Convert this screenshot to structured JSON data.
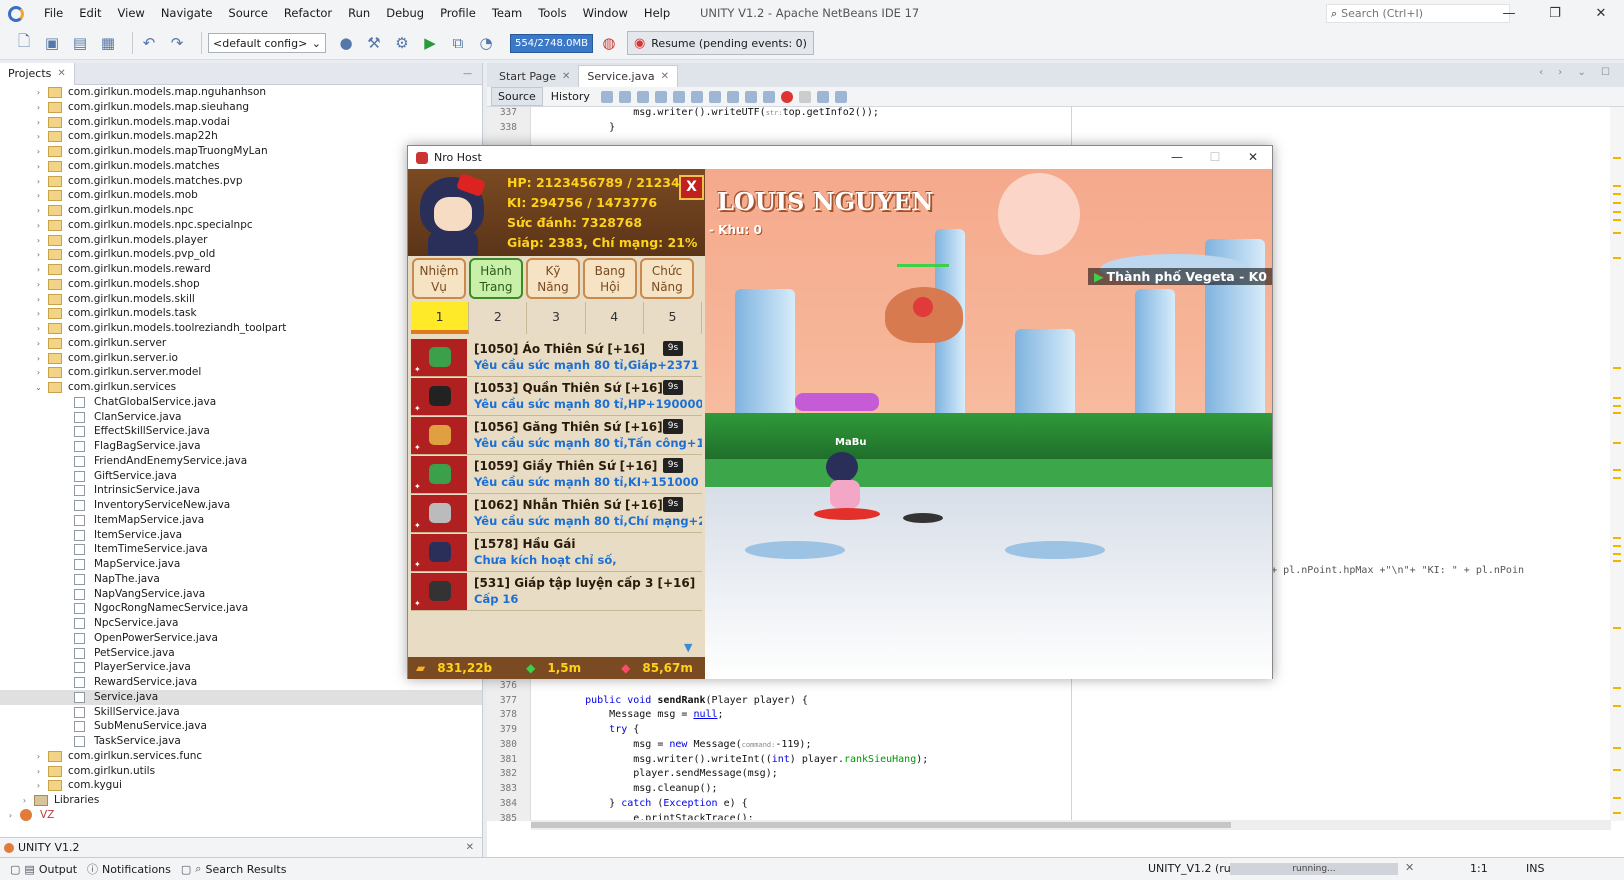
{
  "window": {
    "title": "UNITY V1.2 - Apache NetBeans IDE 17",
    "minimize": "—",
    "maximize": "❐",
    "close": "✕"
  },
  "menu": [
    "File",
    "Edit",
    "View",
    "Navigate",
    "Source",
    "Refactor",
    "Run",
    "Debug",
    "Profile",
    "Team",
    "Tools",
    "Window",
    "Help"
  ],
  "search": {
    "placeholder": "Search (Ctrl+I)"
  },
  "toolbar": {
    "config": "<default config>",
    "memory": "554/2748.0MB",
    "resume": "Resume (pending events: 0)"
  },
  "projects": {
    "tab": "Projects",
    "close": "✕",
    "minimize": "—",
    "rows": [
      {
        "text": "com.girlkun.models.map.nguhanhson",
        "kind": "pkg",
        "indent": 2,
        "tw": "›"
      },
      {
        "text": "com.girlkun.models.map.sieuhang",
        "kind": "pkg",
        "indent": 2,
        "tw": "›"
      },
      {
        "text": "com.girlkun.models.map.vodai",
        "kind": "pkg",
        "indent": 2,
        "tw": "›"
      },
      {
        "text": "com.girlkun.models.map22h",
        "kind": "pkg",
        "indent": 2,
        "tw": "›"
      },
      {
        "text": "com.girlkun.models.mapTruongMyLan",
        "kind": "pkg",
        "indent": 2,
        "tw": "›"
      },
      {
        "text": "com.girlkun.models.matches",
        "kind": "pkg",
        "indent": 2,
        "tw": "›"
      },
      {
        "text": "com.girlkun.models.matches.pvp",
        "kind": "pkg",
        "indent": 2,
        "tw": "›"
      },
      {
        "text": "com.girlkun.models.mob",
        "kind": "pkg",
        "indent": 2,
        "tw": "›"
      },
      {
        "text": "com.girlkun.models.npc",
        "kind": "pkg",
        "indent": 2,
        "tw": "›"
      },
      {
        "text": "com.girlkun.models.npc.specialnpc",
        "kind": "pkg",
        "indent": 2,
        "tw": "›"
      },
      {
        "text": "com.girlkun.models.player",
        "kind": "pkg",
        "indent": 2,
        "tw": "›"
      },
      {
        "text": "com.girlkun.models.pvp_old",
        "kind": "pkg",
        "indent": 2,
        "tw": "›"
      },
      {
        "text": "com.girlkun.models.reward",
        "kind": "pkg",
        "indent": 2,
        "tw": "›"
      },
      {
        "text": "com.girlkun.models.shop",
        "kind": "pkg",
        "indent": 2,
        "tw": "›"
      },
      {
        "text": "com.girlkun.models.skill",
        "kind": "pkg",
        "indent": 2,
        "tw": "›"
      },
      {
        "text": "com.girlkun.models.task",
        "kind": "pkg",
        "indent": 2,
        "tw": "›"
      },
      {
        "text": "com.girlkun.models.toolreziandh_toolpart",
        "kind": "pkg",
        "indent": 2,
        "tw": "›"
      },
      {
        "text": "com.girlkun.server",
        "kind": "pkg",
        "indent": 2,
        "tw": "›"
      },
      {
        "text": "com.girlkun.server.io",
        "kind": "pkg",
        "indent": 2,
        "tw": "›"
      },
      {
        "text": "com.girlkun.server.model",
        "kind": "pkg",
        "indent": 2,
        "tw": "›"
      },
      {
        "text": "com.girlkun.services",
        "kind": "pkg",
        "indent": 2,
        "tw": "⌄"
      },
      {
        "text": "ChatGlobalService.java",
        "kind": "file",
        "indent": 3,
        "tw": ""
      },
      {
        "text": "ClanService.java",
        "kind": "file",
        "indent": 3,
        "tw": ""
      },
      {
        "text": "EffectSkillService.java",
        "kind": "file",
        "indent": 3,
        "tw": ""
      },
      {
        "text": "FlagBagService.java",
        "kind": "file",
        "indent": 3,
        "tw": ""
      },
      {
        "text": "FriendAndEnemyService.java",
        "kind": "file",
        "indent": 3,
        "tw": ""
      },
      {
        "text": "GiftService.java",
        "kind": "file",
        "indent": 3,
        "tw": ""
      },
      {
        "text": "IntrinsicService.java",
        "kind": "file",
        "indent": 3,
        "tw": ""
      },
      {
        "text": "InventoryServiceNew.java",
        "kind": "file",
        "indent": 3,
        "tw": ""
      },
      {
        "text": "ItemMapService.java",
        "kind": "file",
        "indent": 3,
        "tw": ""
      },
      {
        "text": "ItemService.java",
        "kind": "file",
        "indent": 3,
        "tw": ""
      },
      {
        "text": "ItemTimeService.java",
        "kind": "file",
        "indent": 3,
        "tw": ""
      },
      {
        "text": "MapService.java",
        "kind": "file",
        "indent": 3,
        "tw": ""
      },
      {
        "text": "NapThe.java",
        "kind": "file",
        "indent": 3,
        "tw": ""
      },
      {
        "text": "NapVangService.java",
        "kind": "file",
        "indent": 3,
        "tw": ""
      },
      {
        "text": "NgocRongNamecService.java",
        "kind": "file",
        "indent": 3,
        "tw": ""
      },
      {
        "text": "NpcService.java",
        "kind": "file",
        "indent": 3,
        "tw": ""
      },
      {
        "text": "OpenPowerService.java",
        "kind": "file",
        "indent": 3,
        "tw": ""
      },
      {
        "text": "PetService.java",
        "kind": "file",
        "indent": 3,
        "tw": ""
      },
      {
        "text": "PlayerService.java",
        "kind": "file",
        "indent": 3,
        "tw": ""
      },
      {
        "text": "RewardService.java",
        "kind": "file",
        "indent": 3,
        "tw": ""
      },
      {
        "text": "Service.java",
        "kind": "file",
        "indent": 3,
        "tw": "",
        "selected": true
      },
      {
        "text": "SkillService.java",
        "kind": "file",
        "indent": 3,
        "tw": ""
      },
      {
        "text": "SubMenuService.java",
        "kind": "file",
        "indent": 3,
        "tw": ""
      },
      {
        "text": "TaskService.java",
        "kind": "file",
        "indent": 3,
        "tw": ""
      },
      {
        "text": "com.girlkun.services.func",
        "kind": "pkg",
        "indent": 2,
        "tw": "›"
      },
      {
        "text": "com.girlkun.utils",
        "kind": "pkg",
        "indent": 2,
        "tw": "›"
      },
      {
        "text": "com.kygui",
        "kind": "pkg",
        "indent": 2,
        "tw": "›"
      },
      {
        "text": "Libraries",
        "kind": "lib",
        "indent": 1,
        "tw": "›"
      },
      {
        "text": "VZ",
        "kind": "proj2",
        "indent": 0,
        "tw": "›"
      }
    ],
    "footer": "UNITY V1.2",
    "footer_close": "✕"
  },
  "editor": {
    "tabs": [
      {
        "label": "Start Page",
        "active": false
      },
      {
        "label": "Service.java",
        "active": true
      }
    ],
    "close": "✕",
    "source": "Source",
    "history": "History",
    "lines_top": [
      {
        "n": "337",
        "html": "            msg.writer().writeUTF(<span class='hint'>str:</span>top.getInfo2());"
      },
      {
        "n": "338",
        "html": "        }"
      }
    ],
    "overflow_text": "HP: \" + pl.nPoint.hpMax +\"\\n\"+ \"KI: \" + pl.nPoin",
    "lines_bottom": [
      {
        "n": "375",
        "html": "    }"
      },
      {
        "n": "376",
        "html": ""
      },
      {
        "n": "377",
        "html": "    <span class='kw'>public void</span> <span class='mth'>sendRank</span>(Player player) {"
      },
      {
        "n": "378",
        "html": "        Message msg = <span class='lit'>null</span>;"
      },
      {
        "n": "379",
        "html": "        <span class='kw'>try</span> {"
      },
      {
        "n": "380",
        "html": "            msg = <span class='kw'>new</span> Message(<span class='hint'>command:</span>-119);"
      },
      {
        "n": "381",
        "html": "            msg.writer().writeInt((<span class='kw'>int</span>) player.<span class='fld'>rankSieuHang</span>);"
      },
      {
        "n": "382",
        "html": "            player.sendMessage(msg);"
      },
      {
        "n": "383",
        "html": "            msg.cleanup();"
      },
      {
        "n": "384",
        "html": "        } <span class='kw'>catch</span> (<span class='kw'>Exception</span> e) {"
      },
      {
        "n": "385",
        "html": "            e.printStackTrace();"
      }
    ]
  },
  "status": {
    "output": "Output",
    "notifications": "Notifications",
    "search_results": "Search Results",
    "run": "UNITY_V1.2 (run)",
    "progress": "running...",
    "progress_close": "✕",
    "position": "1:1",
    "mode": "INS"
  },
  "game": {
    "title": "Nro Host",
    "min": "—",
    "max": "☐",
    "close": "✕",
    "stats": {
      "hp": "HP: 2123456789 / 2123456",
      "ki": "KI: 294756 / 1473776",
      "power": "Sức đánh: 7328768",
      "armor": "Giáp: 2383, Chí mạng: 21%"
    },
    "close_btn": "X",
    "tabs": [
      {
        "l1": "Nhiệm",
        "l2": "Vụ",
        "on": false
      },
      {
        "l1": "Hành",
        "l2": "Trang",
        "on": true
      },
      {
        "l1": "Kỹ",
        "l2": "Năng",
        "on": false
      },
      {
        "l1": "Bang",
        "l2": "Hội",
        "on": false
      },
      {
        "l1": "Chức",
        "l2": "Năng",
        "on": false
      }
    ],
    "pages": [
      "1",
      "2",
      "3",
      "4",
      "5"
    ],
    "active_page": 0,
    "items": [
      {
        "name": "[1050] Áo Thiên Sứ [+16]",
        "desc": "Yêu cầu sức mạnh 80 tỉ,Giáp+2371",
        "badge": "9s",
        "color": "#3aa04a"
      },
      {
        "name": "[1053] Quần Thiên Sứ [+16]",
        "desc": "Yêu cầu sức mạnh 80 tỉ,HP+190000",
        "badge": "9s",
        "color": "#222222"
      },
      {
        "name": "[1056] Găng Thiên Sứ [+16]",
        "desc": "Yêu cầu sức mạnh 80 tỉ,Tấn công+1",
        "badge": "9s",
        "color": "#e0a040"
      },
      {
        "name": "[1059] Giầy Thiên Sứ [+16]",
        "desc": "Yêu cầu sức mạnh 80 tỉ,KI+151000",
        "badge": "9s",
        "color": "#3aa04a"
      },
      {
        "name": "[1062] Nhẫn Thiên Sứ [+16]",
        "desc": "Yêu cầu sức mạnh 80 tỉ,Chí mạng+2",
        "badge": "9s",
        "color": "#bbbbbb"
      },
      {
        "name": "[1578] Hầu Gái",
        "desc": "Chưa kích hoạt chỉ số,",
        "badge": "",
        "color": "#2a2f5a"
      },
      {
        "name": "[531] Giáp tập luyện cấp 3 [+16]",
        "desc": "Cấp 16",
        "badge": "",
        "color": "#333333"
      }
    ],
    "gold": "831,22b",
    "gems": "1,5m",
    "ruby": "85,67m",
    "scene": {
      "name": "LOUIS NGUYEN",
      "zone": "- Khu: 0",
      "map": "Thành phố Vegeta - K0",
      "boss_tag": "MaBu"
    }
  }
}
